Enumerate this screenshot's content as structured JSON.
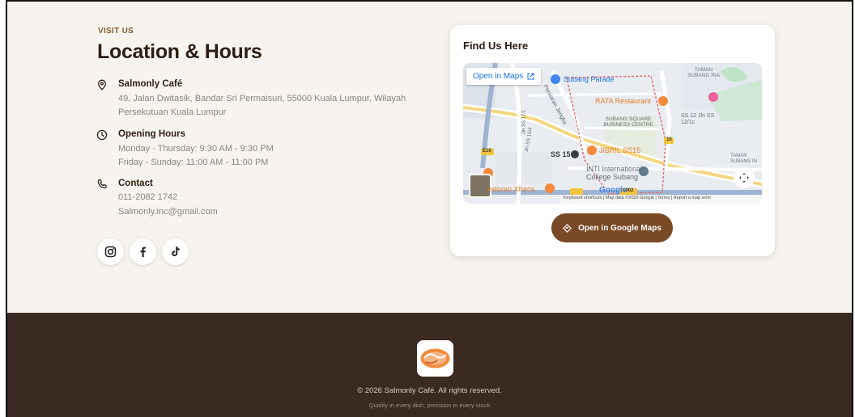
{
  "section": {
    "eyebrow": "VISIT US",
    "title": "Location & Hours"
  },
  "address": {
    "icon": "map-pin-icon",
    "heading": "Salmonly Café",
    "line1": "49, Jalan Dwitasik, Bandar Sri Permaisuri, 55000 Kuala Lumpur, Wilayah",
    "line2": "Persekutuan Kuala Lumpur"
  },
  "hours": {
    "icon": "clock-icon",
    "heading": "Opening Hours",
    "line1": "Monday - Thursday: 9:30 AM - 9:30 PM",
    "line2": "Friday - Sunday: 11:00 AM - 11:00 PM"
  },
  "contact": {
    "icon": "phone-icon",
    "heading": "Contact",
    "phone": "011-2082 1742",
    "email": "Salmonly.inc@gmail.com"
  },
  "socials": [
    "instagram-icon",
    "facebook-icon",
    "tiktok-icon"
  ],
  "map_card": {
    "title": "Find Us Here",
    "open_in_maps": "Open in Maps",
    "labels": {
      "subang_parade": "Subang Parade",
      "taman_subang_ria": "TAMAN SUBANG RIA",
      "rata_restaurant": "RATA Restaurant",
      "subang_square": "SUBANG SQUARE BUSINESS CENTRE",
      "jibril": "JIBRIL SS15",
      "ss15": "SS 15",
      "inti": "INTI International College Subang",
      "restoran": "estoran Xfrens",
      "ss12": "SS 12 Jln SS 12/1c",
      "taman_subang_in": "TAMAN SUBANG IN",
      "persiaran": "Persiaran Jengka",
      "jln_ss17": "Jln SS 17/1",
      "jln_ss15": "Jln SS 15/4",
      "e10": "E10",
      "r15": "15",
      "r1002": "1002"
    },
    "attribution": {
      "google": "Google",
      "keyboard": "Keyboard shortcuts",
      "mapdata": "Map data ©2026 Google",
      "terms": "Terms",
      "report": "Report a map error"
    },
    "google_maps_button": "Open in Google Maps"
  },
  "colors": {
    "brand_brown": "#7a4a26",
    "footer_bg": "#3b2a22",
    "accent_text": "#8a5a2b"
  },
  "footer": {
    "copyright": "© 2026 Salmonly Café. All rights reserved.",
    "tagline": "Quality in every dish, precision in every stock"
  }
}
